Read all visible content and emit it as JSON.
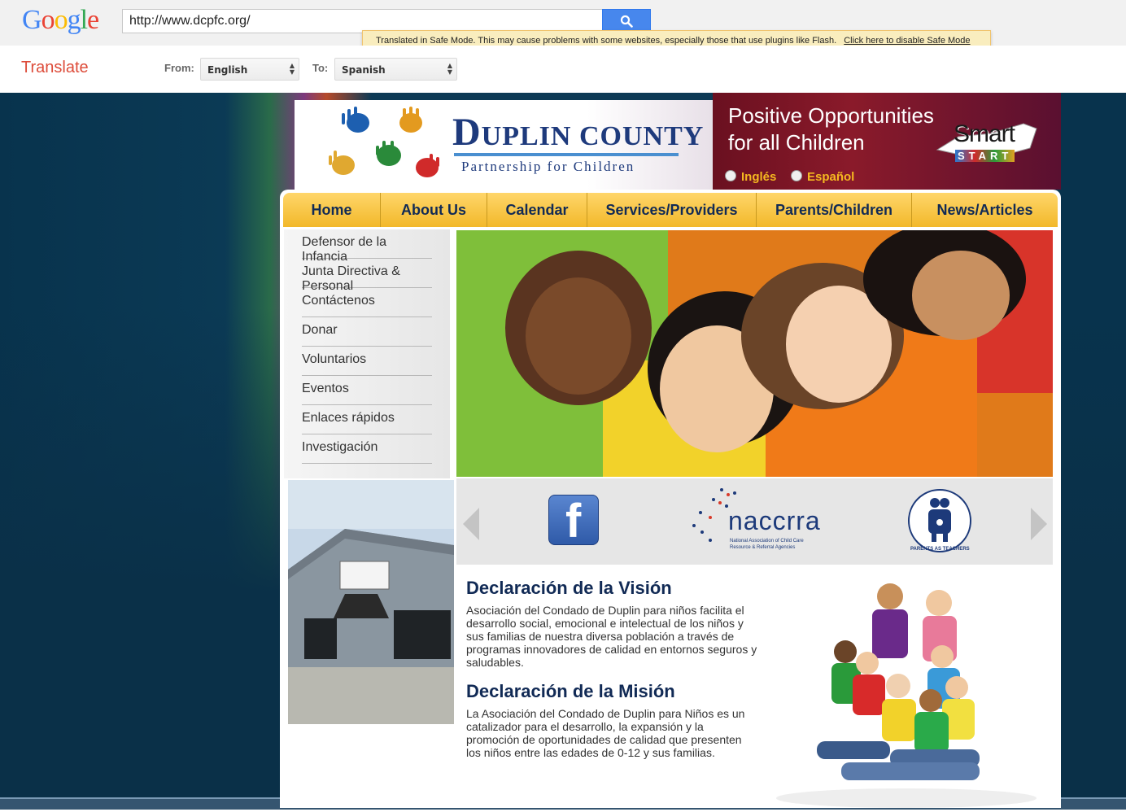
{
  "google": {
    "logo": "Google",
    "url_value": "http://www.dcpfc.org/",
    "safe_mode_message": "Translated in Safe Mode. This may cause problems with some websites, especially those that use plugins like Flash.",
    "safe_mode_link": "Click here to disable Safe Mode",
    "translate_title": "Translate",
    "from_label": "From:",
    "from_value": "English",
    "to_label": "To:",
    "to_value": "Spanish"
  },
  "site": {
    "logo_title_initial": "D",
    "logo_title_rest": "UPLIN COUNTY",
    "logo_subtitle": "Partnership for Children",
    "tagline_line1": "Positive Opportunities",
    "tagline_line2": "for all Children",
    "smart_start": "Smart",
    "smart_start_sub": "START",
    "lang_english": "Inglés",
    "lang_spanish": "Español",
    "nav": [
      "Home",
      "About Us",
      "Calendar",
      "Services/Providers",
      "Parents/Children",
      "News/Articles"
    ],
    "side_menu": [
      "Defensor de la Infancia",
      "Junta Directiva & Personal",
      "Contáctenos",
      "Donar",
      "Voluntarios",
      "Eventos",
      "Enlaces rápidos",
      "Investigación"
    ],
    "partner_logos": {
      "naccrra_name": "naccrra",
      "naccrra_sub1": "National Association of Child Care",
      "naccrra_sub2": "Resource & Referral Agencies",
      "pat_text": "PARENTS AS TEACHERS"
    },
    "vision_title": "Declaración de la Visión",
    "vision_text": "Asociación del Condado de Duplin para niños facilita el desarrollo social, emocional e intelectual de los niños y sus familias de nuestra diversa población a través de programas innovadores de calidad en entornos seguros y saludables.",
    "mission_title": "Declaración de la Misión",
    "mission_text": "La Asociación del Condado de Duplin para Niños es un catalizador para el desarrollo, la expansión y la promoción de oportunidades de calidad que presenten los niños entre las edades de 0-12 y sus familias."
  },
  "colors": {
    "google_blue": "#4787ed",
    "translate_red": "#dd4b39",
    "nav_gold": "#f2b82a",
    "navy": "#112a55",
    "banner_maroon": "#8a1a2a"
  }
}
